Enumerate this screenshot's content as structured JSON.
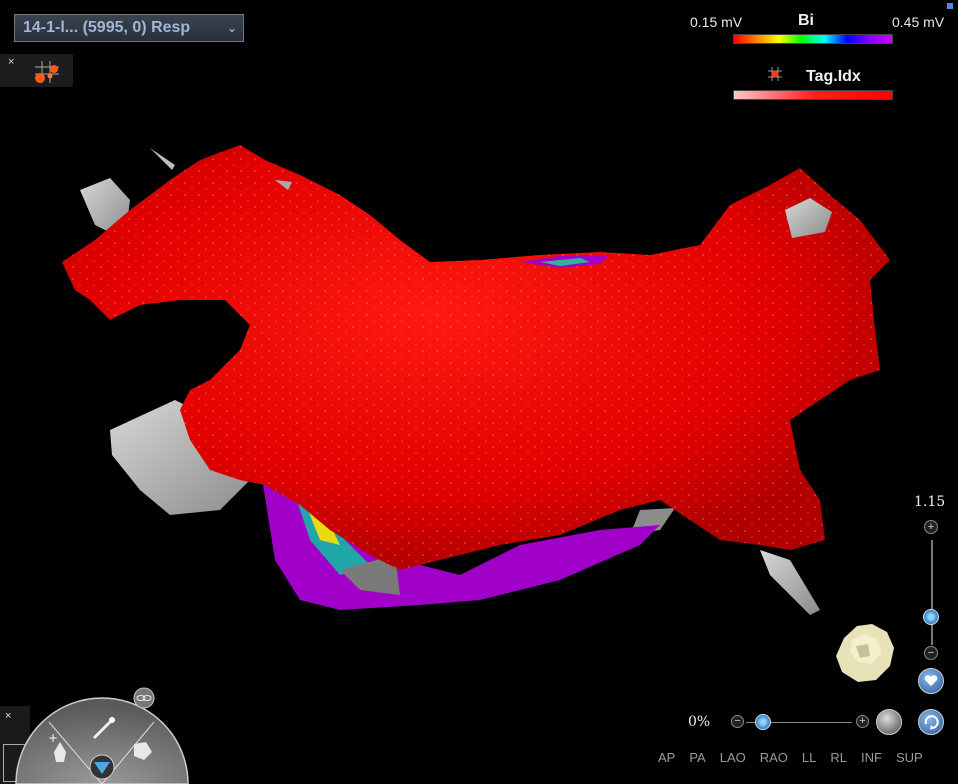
{
  "map_selector": {
    "label": "14-1-l... (5995, 0) Resp",
    "chevron_icon": "chevron-down-icon"
  },
  "tools_panel": {
    "close": "×",
    "icon": "tag-points-grid-icon"
  },
  "voltage_legend": {
    "min": "0.15 mV",
    "type": "Bi",
    "max": "0.45 mV"
  },
  "tag_legend": {
    "icon": "tag-index-icon",
    "label": "Tag.Idx"
  },
  "zoom": {
    "value": "1.15",
    "plus": "+",
    "minus": "−",
    "level": 0.35
  },
  "opacity": {
    "value": "0%",
    "minus": "−",
    "plus": "+",
    "level": 0.08
  },
  "view_buttons": [
    "AP",
    "PA",
    "LAO",
    "RAO",
    "LL",
    "RL",
    "INF",
    "SUP"
  ],
  "left_panel": {
    "close": "×"
  },
  "colors": {
    "surface": "#e80000",
    "scar": "#a000c8",
    "background": "#000000",
    "accent": "#2a7fc8"
  }
}
